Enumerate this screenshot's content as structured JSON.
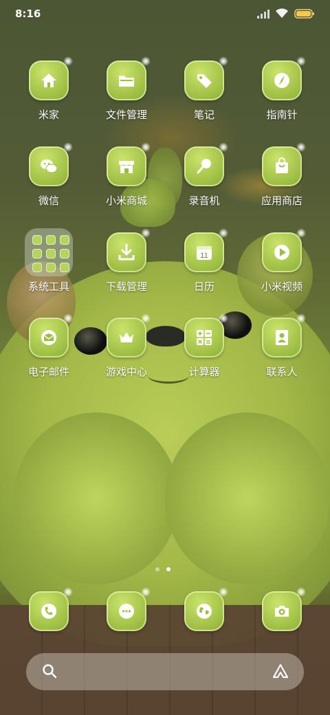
{
  "status_bar": {
    "time": "8:16",
    "icons": [
      "signal-icon",
      "wifi-icon",
      "battery-icon"
    ]
  },
  "apps": [
    {
      "label": "米家",
      "icon": "home-icon"
    },
    {
      "label": "文件管理",
      "icon": "folder-icon"
    },
    {
      "label": "笔记",
      "icon": "tag-icon"
    },
    {
      "label": "指南针",
      "icon": "compass-icon"
    },
    {
      "label": "微信",
      "icon": "wechat-icon"
    },
    {
      "label": "小米商城",
      "icon": "store-icon"
    },
    {
      "label": "录音机",
      "icon": "microphone-icon"
    },
    {
      "label": "应用商店",
      "icon": "shopping-bag-icon"
    },
    {
      "label": "系统工具",
      "icon": "folder-grid-icon"
    },
    {
      "label": "下载管理",
      "icon": "download-icon"
    },
    {
      "label": "日历",
      "icon": "calendar-icon",
      "badge": "11"
    },
    {
      "label": "小米视频",
      "icon": "play-icon"
    },
    {
      "label": "电子邮件",
      "icon": "mail-icon"
    },
    {
      "label": "游戏中心",
      "icon": "crown-icon"
    },
    {
      "label": "计算器",
      "icon": "calculator-icon"
    },
    {
      "label": "联系人",
      "icon": "contact-card-icon"
    }
  ],
  "dock": [
    {
      "icon": "phone-icon"
    },
    {
      "icon": "message-icon"
    },
    {
      "icon": "browser-globe-icon"
    },
    {
      "icon": "camera-icon"
    }
  ],
  "page_indicator": {
    "count": 2,
    "active": 2
  },
  "search_bar": {
    "left_icon": "search-icon",
    "right_icon": "assistant-icon"
  },
  "colors": {
    "icon_green": "#a7c64b",
    "label_white": "#ffffff"
  }
}
